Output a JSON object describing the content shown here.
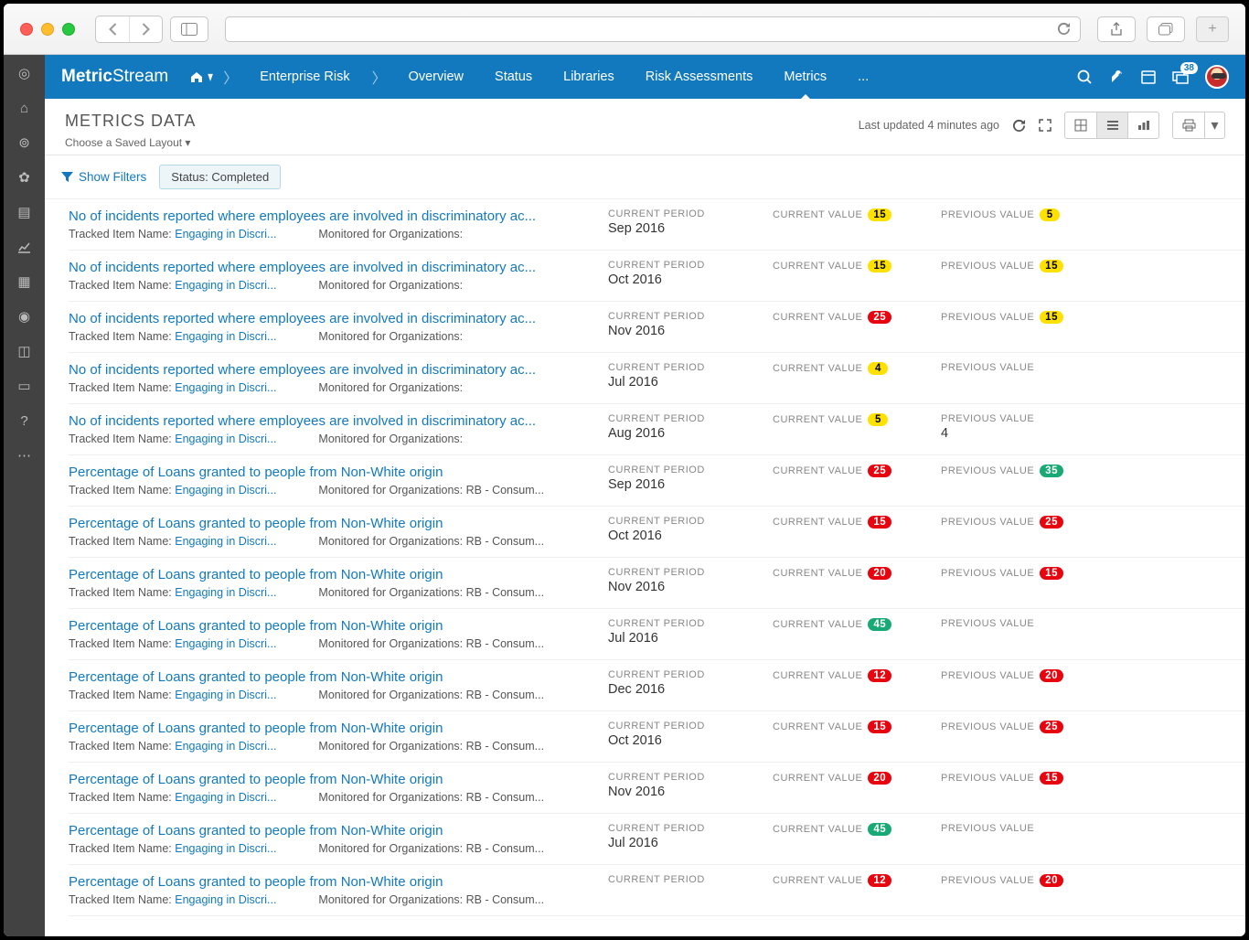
{
  "brand": {
    "bold": "Metric",
    "light": "Stream"
  },
  "breadcrumb": {
    "parent": "Enterprise Risk"
  },
  "nav": {
    "items": [
      "Overview",
      "Status",
      "Libraries",
      "Risk Assessments",
      "Metrics",
      "..."
    ],
    "active": "Metrics"
  },
  "notification_count": "38",
  "page_title": "METRICS DATA",
  "saved_layout_label": "Choose a Saved Layout",
  "last_updated": "Last updated 4 minutes ago",
  "show_filters_label": "Show Filters",
  "filter_chip": "Status: Completed",
  "labels": {
    "tracked_item": "Tracked Item Name:",
    "monitored": "Monitored for Organizations:",
    "current_period": "CURRENT PERIOD",
    "current_value": "CURRENT VALUE",
    "previous_value": "PREVIOUS VALUE"
  },
  "rows": [
    {
      "title": "No of incidents reported where employees are involved in discriminatory ac...",
      "tracked": "Engaging in Discri...",
      "org": "",
      "period": "Sep 2016",
      "cur": {
        "v": "15",
        "c": "yellow"
      },
      "prev": {
        "v": "5",
        "c": "yellow"
      }
    },
    {
      "title": "No of incidents reported where employees are involved in discriminatory ac...",
      "tracked": "Engaging in Discri...",
      "org": "",
      "period": "Oct 2016",
      "cur": {
        "v": "15",
        "c": "yellow"
      },
      "prev": {
        "v": "15",
        "c": "yellow"
      }
    },
    {
      "title": "No of incidents reported where employees are involved in discriminatory ac...",
      "tracked": "Engaging in Discri...",
      "org": "",
      "period": "Nov 2016",
      "cur": {
        "v": "25",
        "c": "red"
      },
      "prev": {
        "v": "15",
        "c": "yellow"
      }
    },
    {
      "title": "No of incidents reported where employees are involved in discriminatory ac...",
      "tracked": "Engaging in Discri...",
      "org": "",
      "period": "Jul 2016",
      "cur": {
        "v": "4",
        "c": "yellow"
      },
      "prev": {
        "v": "",
        "c": ""
      }
    },
    {
      "title": "No of incidents reported where employees are involved in discriminatory ac...",
      "tracked": "Engaging in Discri...",
      "org": "",
      "period": "Aug 2016",
      "cur": {
        "v": "5",
        "c": "yellow"
      },
      "prev": {
        "v": "4",
        "c": "plain"
      }
    },
    {
      "title": "Percentage of Loans granted to people from Non-White origin",
      "tracked": "Engaging in Discri...",
      "org": "RB - Consum...",
      "period": "Sep 2016",
      "cur": {
        "v": "25",
        "c": "red"
      },
      "prev": {
        "v": "35",
        "c": "green"
      }
    },
    {
      "title": "Percentage of Loans granted to people from Non-White origin",
      "tracked": "Engaging in Discri...",
      "org": "RB - Consum...",
      "period": "Oct 2016",
      "cur": {
        "v": "15",
        "c": "red"
      },
      "prev": {
        "v": "25",
        "c": "red"
      }
    },
    {
      "title": "Percentage of Loans granted to people from Non-White origin",
      "tracked": "Engaging in Discri...",
      "org": "RB - Consum...",
      "period": "Nov 2016",
      "cur": {
        "v": "20",
        "c": "red"
      },
      "prev": {
        "v": "15",
        "c": "red"
      }
    },
    {
      "title": "Percentage of Loans granted to people from Non-White origin",
      "tracked": "Engaging in Discri...",
      "org": "RB - Consum...",
      "period": "Jul 2016",
      "cur": {
        "v": "45",
        "c": "green"
      },
      "prev": {
        "v": "",
        "c": ""
      }
    },
    {
      "title": "Percentage of Loans granted to people from Non-White origin",
      "tracked": "Engaging in Discri...",
      "org": "RB - Consum...",
      "period": "Dec 2016",
      "cur": {
        "v": "12",
        "c": "red"
      },
      "prev": {
        "v": "20",
        "c": "red"
      }
    },
    {
      "title": "Percentage of Loans granted to people from Non-White origin",
      "tracked": "Engaging in Discri...",
      "org": "RB - Consum...",
      "period": "Oct 2016",
      "cur": {
        "v": "15",
        "c": "red"
      },
      "prev": {
        "v": "25",
        "c": "red"
      }
    },
    {
      "title": "Percentage of Loans granted to people from Non-White origin",
      "tracked": "Engaging in Discri...",
      "org": "RB - Consum...",
      "period": "Nov 2016",
      "cur": {
        "v": "20",
        "c": "red"
      },
      "prev": {
        "v": "15",
        "c": "red"
      }
    },
    {
      "title": "Percentage of Loans granted to people from Non-White origin",
      "tracked": "Engaging in Discri...",
      "org": "RB - Consum...",
      "period": "Jul 2016",
      "cur": {
        "v": "45",
        "c": "green"
      },
      "prev": {
        "v": "",
        "c": ""
      }
    },
    {
      "title": "Percentage of Loans granted to people from Non-White origin",
      "tracked": "Engaging in Discri...",
      "org": "RB - Consum...",
      "period": "",
      "cur": {
        "v": "12",
        "c": "red"
      },
      "prev": {
        "v": "20",
        "c": "red"
      }
    }
  ]
}
